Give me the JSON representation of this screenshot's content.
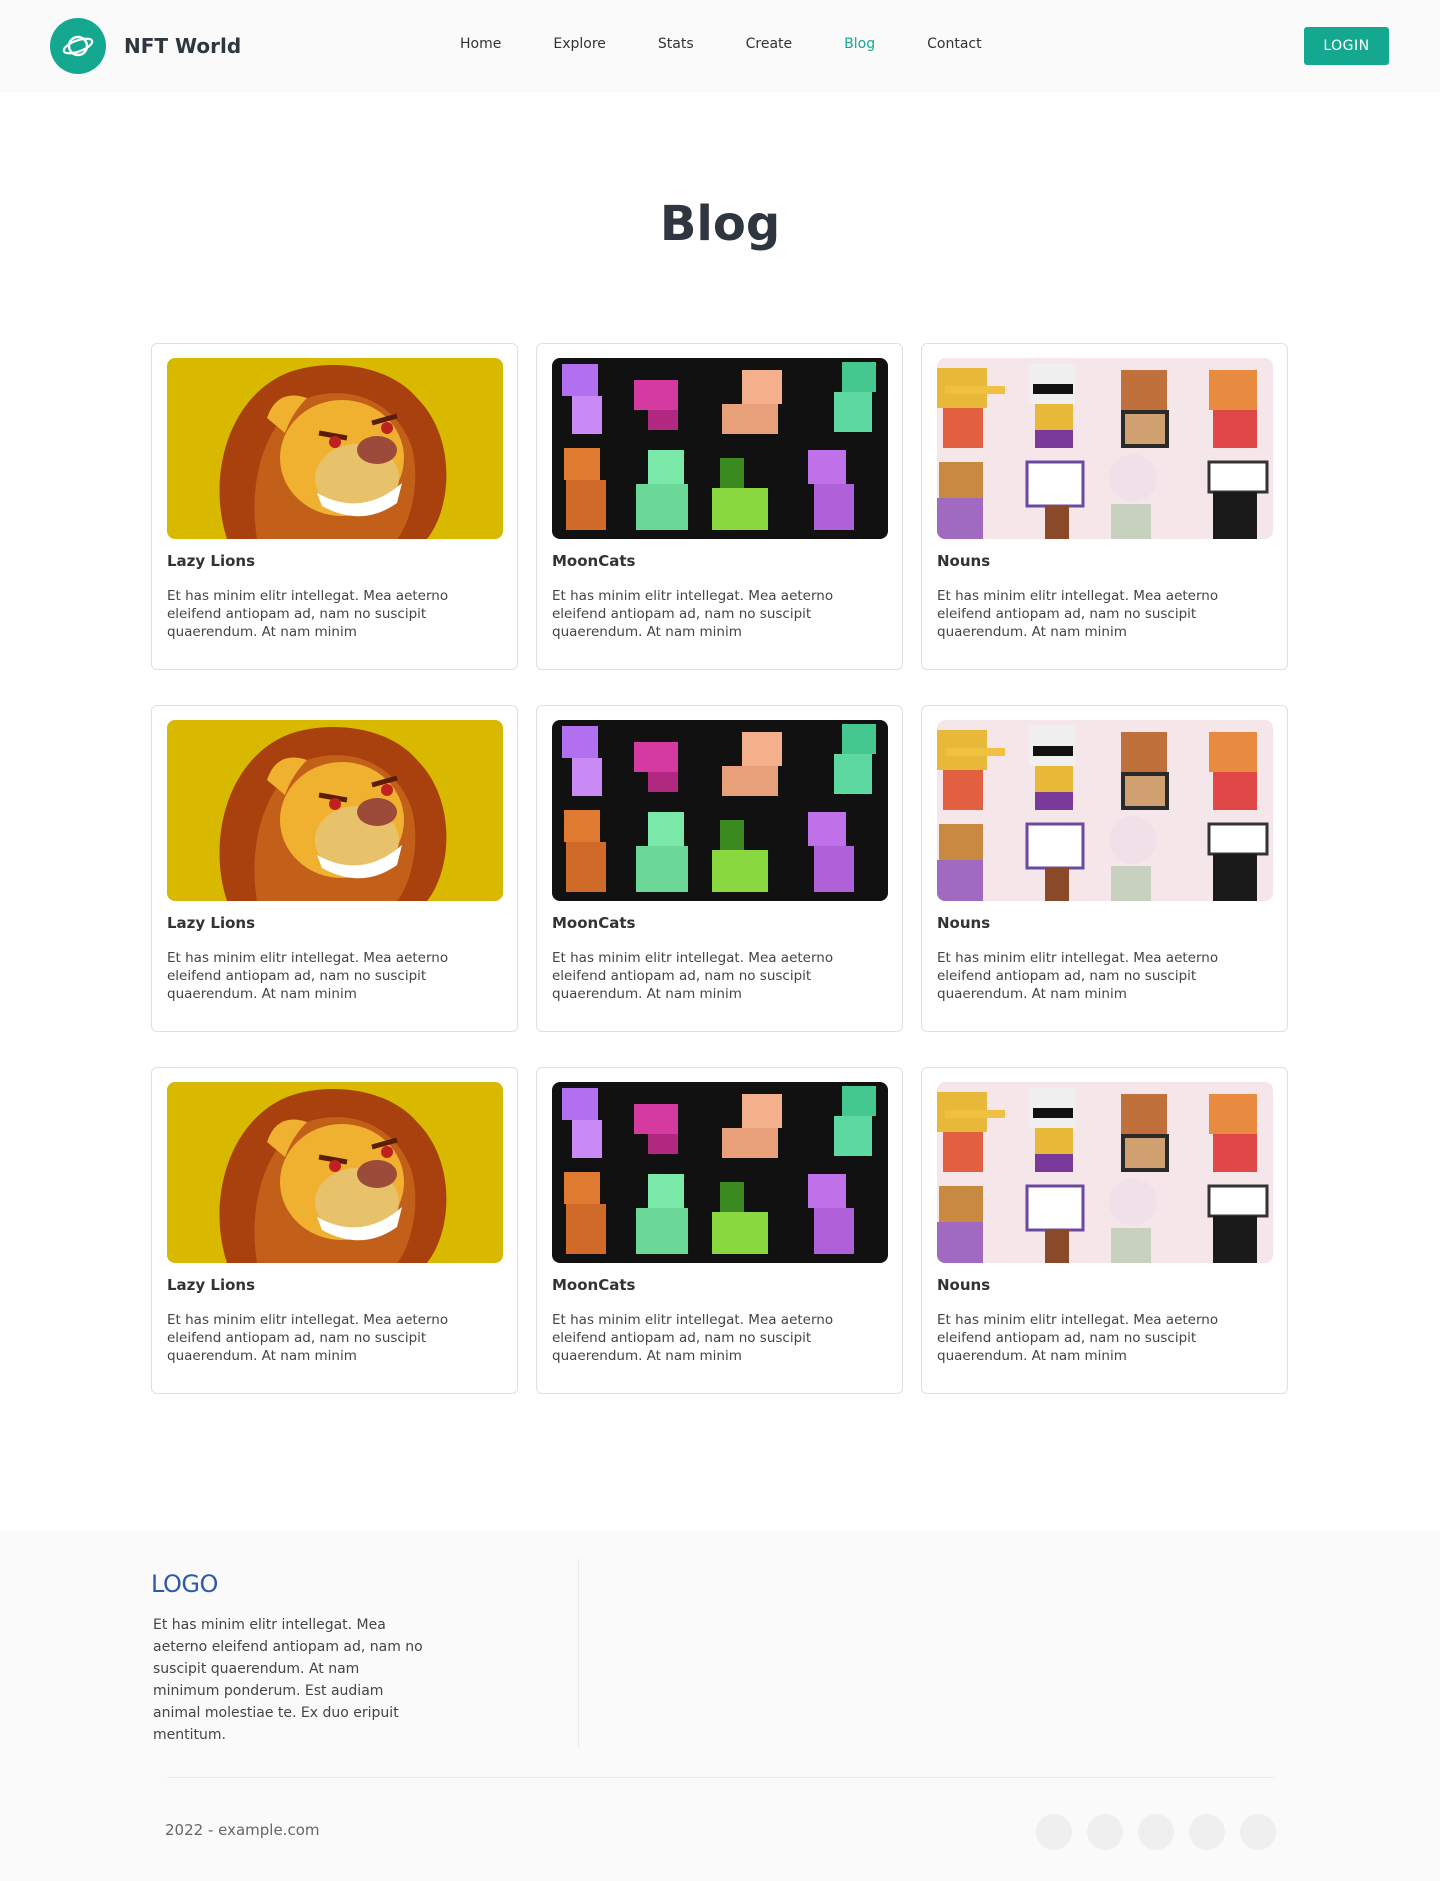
{
  "header": {
    "brand_name": "NFT World",
    "nav": [
      {
        "label": "Home",
        "active": false
      },
      {
        "label": "Explore",
        "active": false
      },
      {
        "label": "Stats",
        "active": false
      },
      {
        "label": "Create",
        "active": false
      },
      {
        "label": "Blog",
        "active": true
      },
      {
        "label": "Contact",
        "active": false
      }
    ],
    "login_label": "LOGIN"
  },
  "page": {
    "title": "Blog"
  },
  "cards": [
    {
      "title": "Lazy Lions",
      "text": "Et has minim elitr intellegat. Mea aeterno eleifend antiopam ad, nam no suscipit quaerendum. At nam minim",
      "image": "lion-illustration"
    },
    {
      "title": "MoonCats",
      "text": "Et has minim elitr intellegat. Mea aeterno eleifend antiopam ad, nam no suscipit quaerendum. At nam minim",
      "image": "pixel-cats"
    },
    {
      "title": "Nouns",
      "text": "Et has minim elitr intellegat. Mea aeterno eleifend antiopam ad, nam no suscipit quaerendum. At nam minim",
      "image": "pixel-nouns"
    },
    {
      "title": "Lazy Lions",
      "text": "Et has minim elitr intellegat. Mea aeterno eleifend antiopam ad, nam no suscipit quaerendum. At nam minim",
      "image": "lion-illustration"
    },
    {
      "title": "MoonCats",
      "text": "Et has minim elitr intellegat. Mea aeterno eleifend antiopam ad, nam no suscipit quaerendum. At nam minim",
      "image": "pixel-cats"
    },
    {
      "title": "Nouns",
      "text": "Et has minim elitr intellegat. Mea aeterno eleifend antiopam ad, nam no suscipit quaerendum. At nam minim",
      "image": "pixel-nouns"
    },
    {
      "title": "Lazy Lions",
      "text": "Et has minim elitr intellegat. Mea aeterno eleifend antiopam ad, nam no suscipit quaerendum. At nam minim",
      "image": "lion-illustration"
    },
    {
      "title": "MoonCats",
      "text": "Et has minim elitr intellegat. Mea aeterno eleifend antiopam ad, nam no suscipit quaerendum. At nam minim",
      "image": "pixel-cats"
    },
    {
      "title": "Nouns",
      "text": "Et has minim elitr intellegat. Mea aeterno eleifend antiopam ad, nam no suscipit quaerendum. At nam minim",
      "image": "pixel-nouns"
    }
  ],
  "footer": {
    "logo": "LOGO",
    "text": "Et has minim elitr intellegat. Mea aeterno eleifend antiopam ad, nam no suscipit quaerendum. At nam minimum ponderum. Est audiam animal molestiae te. Ex duo eripuit mentitum.",
    "copyright": "2022 - example.com",
    "social_icons": [
      "social-icon-1",
      "social-icon-2",
      "social-icon-3",
      "social-icon-4",
      "social-icon-5"
    ]
  },
  "colors": {
    "accent": "#14a890",
    "heading": "#2f3640",
    "footer_logo": "#2f5aa8",
    "lion_bg": "#d9b800",
    "cats_bg": "#111111",
    "nouns_bg": "#f5e6ea"
  }
}
